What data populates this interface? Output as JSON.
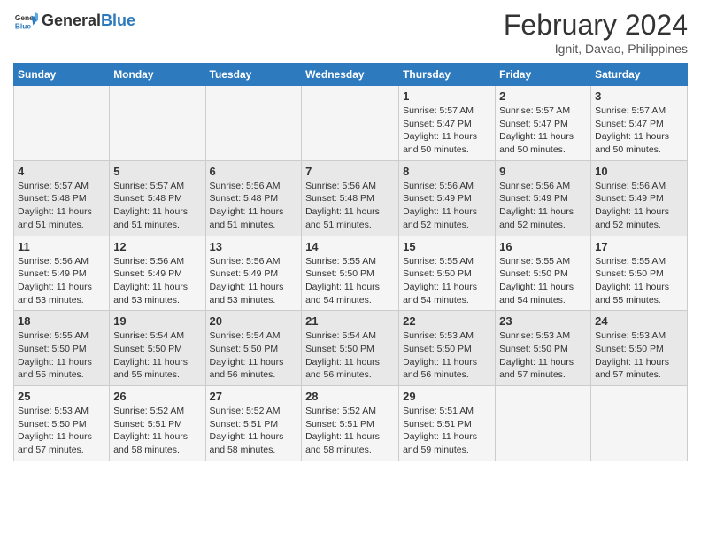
{
  "header": {
    "logo_line1": "General",
    "logo_line2": "Blue",
    "month": "February 2024",
    "location": "Ignit, Davao, Philippines"
  },
  "columns": [
    "Sunday",
    "Monday",
    "Tuesday",
    "Wednesday",
    "Thursday",
    "Friday",
    "Saturday"
  ],
  "weeks": [
    {
      "days": [
        {
          "num": "",
          "info": ""
        },
        {
          "num": "",
          "info": ""
        },
        {
          "num": "",
          "info": ""
        },
        {
          "num": "",
          "info": ""
        },
        {
          "num": "1",
          "info": "Sunrise: 5:57 AM\nSunset: 5:47 PM\nDaylight: 11 hours\nand 50 minutes."
        },
        {
          "num": "2",
          "info": "Sunrise: 5:57 AM\nSunset: 5:47 PM\nDaylight: 11 hours\nand 50 minutes."
        },
        {
          "num": "3",
          "info": "Sunrise: 5:57 AM\nSunset: 5:47 PM\nDaylight: 11 hours\nand 50 minutes."
        }
      ]
    },
    {
      "days": [
        {
          "num": "4",
          "info": "Sunrise: 5:57 AM\nSunset: 5:48 PM\nDaylight: 11 hours\nand 51 minutes."
        },
        {
          "num": "5",
          "info": "Sunrise: 5:57 AM\nSunset: 5:48 PM\nDaylight: 11 hours\nand 51 minutes."
        },
        {
          "num": "6",
          "info": "Sunrise: 5:56 AM\nSunset: 5:48 PM\nDaylight: 11 hours\nand 51 minutes."
        },
        {
          "num": "7",
          "info": "Sunrise: 5:56 AM\nSunset: 5:48 PM\nDaylight: 11 hours\nand 51 minutes."
        },
        {
          "num": "8",
          "info": "Sunrise: 5:56 AM\nSunset: 5:49 PM\nDaylight: 11 hours\nand 52 minutes."
        },
        {
          "num": "9",
          "info": "Sunrise: 5:56 AM\nSunset: 5:49 PM\nDaylight: 11 hours\nand 52 minutes."
        },
        {
          "num": "10",
          "info": "Sunrise: 5:56 AM\nSunset: 5:49 PM\nDaylight: 11 hours\nand 52 minutes."
        }
      ]
    },
    {
      "days": [
        {
          "num": "11",
          "info": "Sunrise: 5:56 AM\nSunset: 5:49 PM\nDaylight: 11 hours\nand 53 minutes."
        },
        {
          "num": "12",
          "info": "Sunrise: 5:56 AM\nSunset: 5:49 PM\nDaylight: 11 hours\nand 53 minutes."
        },
        {
          "num": "13",
          "info": "Sunrise: 5:56 AM\nSunset: 5:49 PM\nDaylight: 11 hours\nand 53 minutes."
        },
        {
          "num": "14",
          "info": "Sunrise: 5:55 AM\nSunset: 5:50 PM\nDaylight: 11 hours\nand 54 minutes."
        },
        {
          "num": "15",
          "info": "Sunrise: 5:55 AM\nSunset: 5:50 PM\nDaylight: 11 hours\nand 54 minutes."
        },
        {
          "num": "16",
          "info": "Sunrise: 5:55 AM\nSunset: 5:50 PM\nDaylight: 11 hours\nand 54 minutes."
        },
        {
          "num": "17",
          "info": "Sunrise: 5:55 AM\nSunset: 5:50 PM\nDaylight: 11 hours\nand 55 minutes."
        }
      ]
    },
    {
      "days": [
        {
          "num": "18",
          "info": "Sunrise: 5:55 AM\nSunset: 5:50 PM\nDaylight: 11 hours\nand 55 minutes."
        },
        {
          "num": "19",
          "info": "Sunrise: 5:54 AM\nSunset: 5:50 PM\nDaylight: 11 hours\nand 55 minutes."
        },
        {
          "num": "20",
          "info": "Sunrise: 5:54 AM\nSunset: 5:50 PM\nDaylight: 11 hours\nand 56 minutes."
        },
        {
          "num": "21",
          "info": "Sunrise: 5:54 AM\nSunset: 5:50 PM\nDaylight: 11 hours\nand 56 minutes."
        },
        {
          "num": "22",
          "info": "Sunrise: 5:53 AM\nSunset: 5:50 PM\nDaylight: 11 hours\nand 56 minutes."
        },
        {
          "num": "23",
          "info": "Sunrise: 5:53 AM\nSunset: 5:50 PM\nDaylight: 11 hours\nand 57 minutes."
        },
        {
          "num": "24",
          "info": "Sunrise: 5:53 AM\nSunset: 5:50 PM\nDaylight: 11 hours\nand 57 minutes."
        }
      ]
    },
    {
      "days": [
        {
          "num": "25",
          "info": "Sunrise: 5:53 AM\nSunset: 5:50 PM\nDaylight: 11 hours\nand 57 minutes."
        },
        {
          "num": "26",
          "info": "Sunrise: 5:52 AM\nSunset: 5:51 PM\nDaylight: 11 hours\nand 58 minutes."
        },
        {
          "num": "27",
          "info": "Sunrise: 5:52 AM\nSunset: 5:51 PM\nDaylight: 11 hours\nand 58 minutes."
        },
        {
          "num": "28",
          "info": "Sunrise: 5:52 AM\nSunset: 5:51 PM\nDaylight: 11 hours\nand 58 minutes."
        },
        {
          "num": "29",
          "info": "Sunrise: 5:51 AM\nSunset: 5:51 PM\nDaylight: 11 hours\nand 59 minutes."
        },
        {
          "num": "",
          "info": ""
        },
        {
          "num": "",
          "info": ""
        }
      ]
    }
  ]
}
